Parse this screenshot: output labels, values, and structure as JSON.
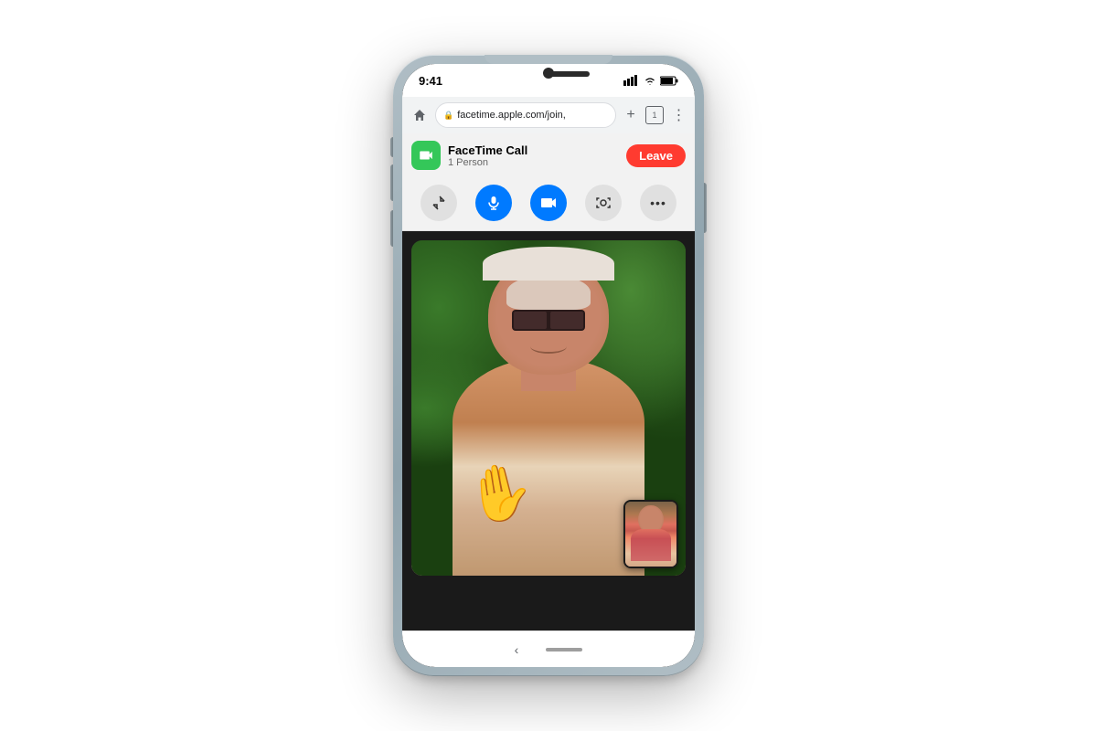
{
  "phone": {
    "status_bar": {
      "time": "9:41",
      "signal": "▲▲",
      "wifi": "wifi",
      "battery": "🔋"
    },
    "address_bar": {
      "url": "facetime.apple.com/join,",
      "lock_symbol": "🔒",
      "tab_count": "1"
    },
    "facetime_bar": {
      "title": "FaceTime Call",
      "subtitle": "1 Person",
      "leave_label": "Leave",
      "icon_alt": "facetime-video-icon"
    },
    "controls": {
      "minimize_label": "↙",
      "mic_label": "🎤",
      "camera_label": "📷",
      "screenshot_label": "📸",
      "more_label": "•••"
    },
    "bottom_nav": {
      "back_label": "‹"
    }
  }
}
